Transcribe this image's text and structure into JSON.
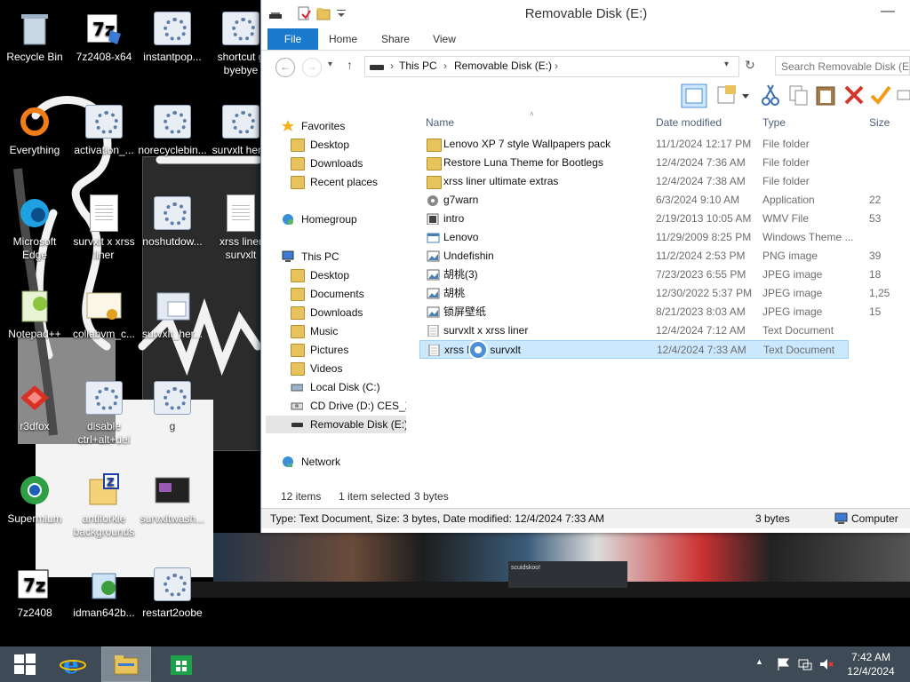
{
  "desktop": {
    "icons": [
      {
        "label": "Recycle Bin",
        "icon": "recycle-bin-icon"
      },
      {
        "label": "7z2408-x64",
        "icon": "installer-icon"
      },
      {
        "label": "instantpop...",
        "icon": "script-icon"
      },
      {
        "label": "shortcut g byebye",
        "icon": "script-icon"
      },
      {
        "label": "Everything",
        "icon": "everything-icon"
      },
      {
        "label": "activation_...",
        "icon": "script-icon"
      },
      {
        "label": "norecyclebin...",
        "icon": "script-icon"
      },
      {
        "label": "survxlt her...",
        "icon": "script-icon"
      },
      {
        "label": "Microsoft Edge",
        "icon": "edge-icon"
      },
      {
        "label": "survxlt x xrss liner",
        "icon": "text-file-icon"
      },
      {
        "label": "noshutdow...",
        "icon": "script-icon"
      },
      {
        "label": "xrss liner survxlt",
        "icon": "text-file-icon"
      },
      {
        "label": "Notepad++",
        "icon": "notepadpp-icon"
      },
      {
        "label": "collabvm_c...",
        "icon": "certificate-icon"
      },
      {
        "label": "survxlt_her...",
        "icon": "window-icon"
      },
      {
        "label": "r3dfox",
        "icon": "r3dfox-icon"
      },
      {
        "label": "disable ctrl+alt+del",
        "icon": "script-icon"
      },
      {
        "label": "g",
        "icon": "script-icon"
      },
      {
        "label": "Supermium",
        "icon": "supermium-icon"
      },
      {
        "label": "antiforkie backgrounds",
        "icon": "archive-icon"
      },
      {
        "label": "survxltwash...",
        "icon": "image-icon"
      },
      {
        "label": "7z2408",
        "icon": "7zip-icon"
      },
      {
        "label": "idman642b...",
        "icon": "installer-icon"
      },
      {
        "label": "restart2oobe",
        "icon": "script-icon"
      }
    ],
    "wallpaper_chat": {
      "user": "scuidskoo!",
      "message": "today is yo u do this stuff promising"
    }
  },
  "explorer": {
    "title": "Removable Disk (E:)",
    "minimize_glyph": "—",
    "ribbon_tabs": [
      "File",
      "Home",
      "Share",
      "View"
    ],
    "address": {
      "crumbs": [
        "This PC",
        "Removable Disk (E:)"
      ],
      "separator": "›"
    },
    "search_placeholder": "Search Removable Disk (E:)",
    "nav": {
      "favorites": {
        "label": "Favorites",
        "items": [
          "Desktop",
          "Downloads",
          "Recent places"
        ]
      },
      "homegroup": "Homegroup",
      "thispc": {
        "label": "This PC",
        "items": [
          "Desktop",
          "Documents",
          "Downloads",
          "Music",
          "Pictures",
          "Videos",
          "Local Disk (C:)",
          "CD Drive (D:) CES_X(",
          "Removable Disk (E:)"
        ]
      },
      "network": "Network"
    },
    "columns": {
      "name": "Name",
      "date": "Date modified",
      "type": "Type",
      "size": "Size"
    },
    "files": [
      {
        "name": "Lenovo XP 7 style Wallpapers pack",
        "date": "11/1/2024 12:17 PM",
        "type": "File folder",
        "size": "",
        "icon": "folder-icon"
      },
      {
        "name": "Restore Luna Theme for Bootlegs",
        "date": "12/4/2024 7:36 AM",
        "type": "File folder",
        "size": "",
        "icon": "folder-icon"
      },
      {
        "name": "xrss liner ultimate extras",
        "date": "12/4/2024 7:38 AM",
        "type": "File folder",
        "size": "",
        "icon": "folder-icon"
      },
      {
        "name": "g7warn",
        "date": "6/3/2024 9:10 AM",
        "type": "Application",
        "size": "22",
        "icon": "application-icon"
      },
      {
        "name": "intro",
        "date": "2/19/2013 10:05 AM",
        "type": "WMV File",
        "size": "53",
        "icon": "video-file-icon"
      },
      {
        "name": "Lenovo",
        "date": "11/29/2009 8:25 PM",
        "type": "Windows Theme ...",
        "size": "",
        "icon": "theme-file-icon"
      },
      {
        "name": "Undefishin",
        "date": "11/2/2024 2:53 PM",
        "type": "PNG image",
        "size": "39",
        "icon": "image-file-icon"
      },
      {
        "name": "胡桃(3)",
        "date": "7/23/2023 6:55 PM",
        "type": "JPEG image",
        "size": "18",
        "icon": "image-file-icon"
      },
      {
        "name": "胡桃",
        "date": "12/30/2022 5:37 PM",
        "type": "JPEG image",
        "size": "1,25",
        "icon": "image-file-icon"
      },
      {
        "name": "锁屏壁纸",
        "date": "8/21/2023 8:03 AM",
        "type": "JPEG image",
        "size": "15",
        "icon": "image-file-icon"
      },
      {
        "name": "survxlt x xrss liner",
        "date": "12/4/2024 7:12 AM",
        "type": "Text Document",
        "size": "",
        "icon": "text-file-icon"
      },
      {
        "name": "xrss liner survxlt",
        "date": "12/4/2024 7:33 AM",
        "type": "Text Document",
        "size": "",
        "icon": "text-file-icon",
        "selected": true
      }
    ],
    "status": {
      "items": "12 items",
      "selected": "1 item selected",
      "size": "3 bytes"
    },
    "details": {
      "text": "Type: Text Document, Size: 3 bytes, Date modified: 12/4/2024 7:33 AM",
      "size": "3 bytes",
      "location": "Computer"
    }
  },
  "taskbar": {
    "clock_time": "7:42 AM",
    "clock_date": "12/4/2024",
    "buttons": [
      "start-icon",
      "internet-explorer-icon",
      "file-explorer-icon",
      "store-icon"
    ]
  },
  "colors": {
    "accent": "#1979ca",
    "selection": "#cce8ff",
    "taskbar": "#3e4a56"
  }
}
